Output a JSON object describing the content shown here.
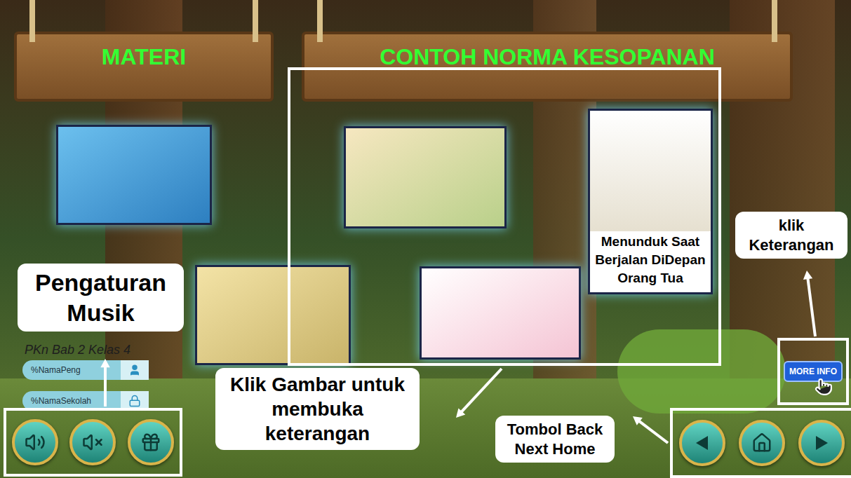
{
  "signs": [
    {
      "label": "MATERI"
    },
    {
      "label": "CONTOH NORMA KESOPANAN"
    }
  ],
  "featured_picture": {
    "caption": "Menunduk Saat Berjalan DiDepan Orang Tua"
  },
  "app_title": "PKn Bab 2 Kelas 4",
  "fields": [
    {
      "value": "%NamaPeng",
      "icon": "user"
    },
    {
      "value": "%NamaSekolah",
      "icon": "lock"
    }
  ],
  "more_info_button": "MORE INFO",
  "annotations": [
    {
      "text": "Pengaturan Musik"
    },
    {
      "text": "Klik Gambar untuk membuka keterangan"
    },
    {
      "text": "Tombol Back Next Home"
    },
    {
      "text": "klik Keterangan"
    }
  ]
}
